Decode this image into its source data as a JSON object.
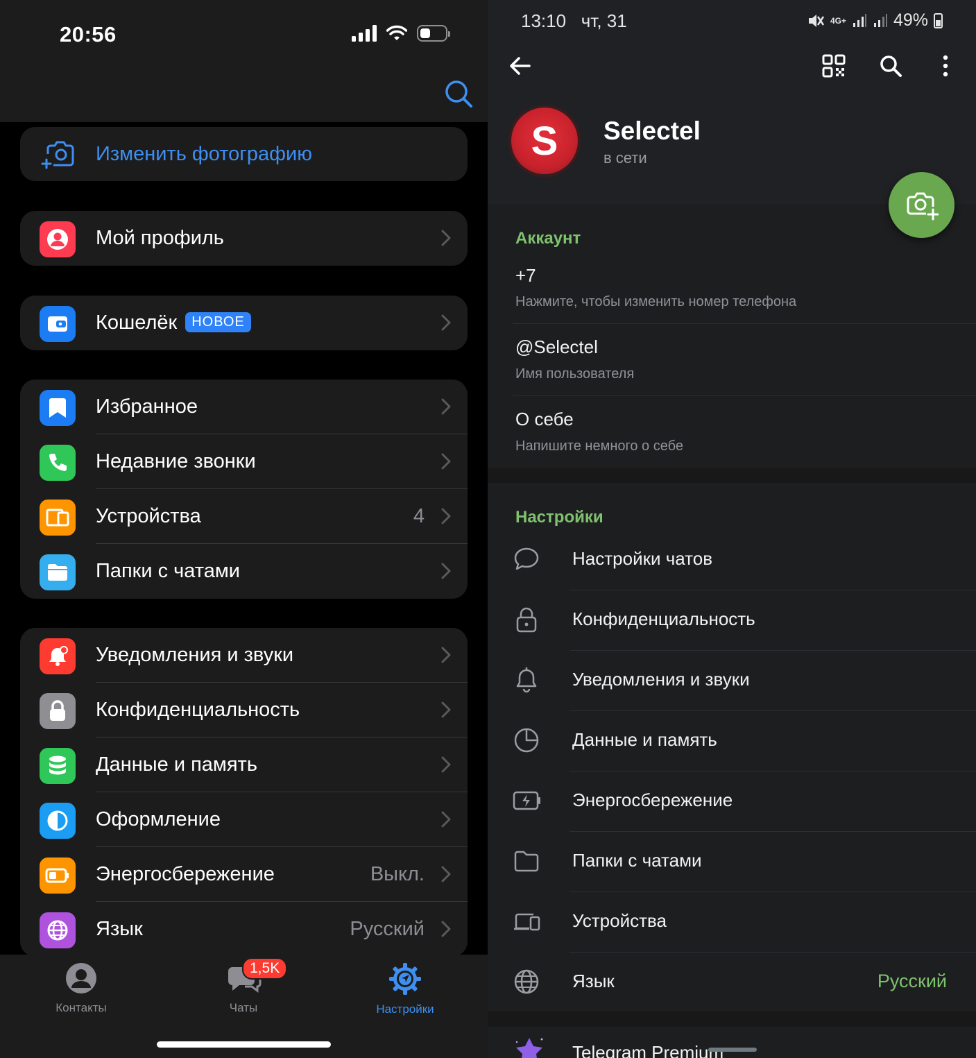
{
  "ios": {
    "status": {
      "time": "20:56"
    },
    "change_photo": "Изменить фотографию",
    "group1": [
      {
        "label": "Мой профиль"
      }
    ],
    "group2": [
      {
        "label": "Кошелёк",
        "badge": "НОВОЕ"
      }
    ],
    "group3": [
      {
        "label": "Избранное"
      },
      {
        "label": "Недавние звонки"
      },
      {
        "label": "Устройства",
        "value": "4"
      },
      {
        "label": "Папки с чатами"
      }
    ],
    "group4": [
      {
        "label": "Уведомления и звуки"
      },
      {
        "label": "Конфиденциальность"
      },
      {
        "label": "Данные и память"
      },
      {
        "label": "Оформление"
      },
      {
        "label": "Энергосбережение",
        "value": "Выкл."
      },
      {
        "label": "Язык",
        "value": "Русский"
      }
    ],
    "tabs": [
      {
        "label": "Контакты"
      },
      {
        "label": "Чаты",
        "badge": "1,5K"
      },
      {
        "label": "Настройки"
      }
    ],
    "colors": {
      "accent": "#3e8ff0",
      "badge": "#fe3b30"
    }
  },
  "android": {
    "status": {
      "time": "13:10",
      "date": "чт, 31",
      "battery": "49%",
      "network": "4G+"
    },
    "profile": {
      "avatar_letter": "S",
      "name": "Selectel",
      "status": "в сети"
    },
    "account": {
      "header": "Аккаунт",
      "phone": "+7",
      "phone_hint": "Нажмите, чтобы изменить номер телефона",
      "username": "@Selectel",
      "username_hint": "Имя пользователя",
      "bio": "О себе",
      "bio_hint": "Напишите немного о себе"
    },
    "settings": {
      "header": "Настройки",
      "items": [
        {
          "label": "Настройки чатов",
          "icon": "chat-bubble-icon"
        },
        {
          "label": "Конфиденциальность",
          "icon": "lock-icon"
        },
        {
          "label": "Уведомления и звуки",
          "icon": "bell-icon"
        },
        {
          "label": "Данные и память",
          "icon": "pie-clock-icon"
        },
        {
          "label": "Энергосбережение",
          "icon": "battery-bolt-icon"
        },
        {
          "label": "Папки с чатами",
          "icon": "folder-icon"
        },
        {
          "label": "Устройства",
          "icon": "devices-icon"
        },
        {
          "label": "Язык",
          "icon": "globe-icon",
          "value": "Русский"
        }
      ]
    },
    "premium": "Telegram Premium",
    "colors": {
      "accent": "#7fc26e",
      "avatar": "#d7262f",
      "fab": "#6aa84f"
    }
  }
}
